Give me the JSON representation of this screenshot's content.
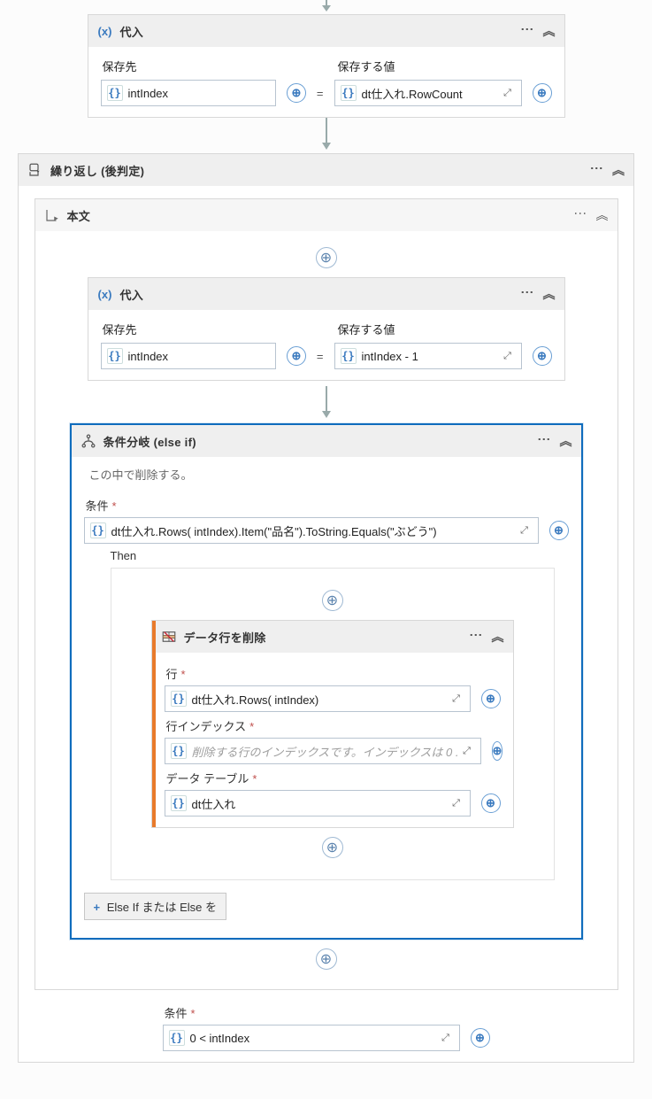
{
  "assign1": {
    "title": "代入",
    "save_to_label": "保存先",
    "save_value_label": "保存する値",
    "save_to": "intIndex",
    "save_value": "dt仕入れ.RowCount"
  },
  "dowhile": {
    "title": "繰り返し (後判定)"
  },
  "body": {
    "title": "本文"
  },
  "assign2": {
    "title": "代入",
    "save_to_label": "保存先",
    "save_value_label": "保存する値",
    "save_to": "intIndex",
    "save_value": "intIndex - 1"
  },
  "elseif": {
    "title": "条件分岐 (else if)",
    "comment": "この中で削除する。",
    "condition_label": "条件",
    "condition": "dt仕入れ.Rows( intIndex).Item(\"品名\").ToString.Equals(\"ぶどう\")",
    "then_label": "Then",
    "addelse_label": "Else If または Else を"
  },
  "removerow": {
    "title": "データ行を削除",
    "row_label": "行",
    "row_value": "dt仕入れ.Rows( intIndex)",
    "rowindex_label": "行インデックス",
    "rowindex_placeholder": "削除する行のインデックスです。インデックスは 0 .",
    "datatable_label": "データ テーブル",
    "datatable_value": "dt仕入れ"
  },
  "dowhile_cond": {
    "label": "条件",
    "value": "0 < intIndex"
  },
  "icons": {
    "var": "（x）",
    "braces": "{ }"
  }
}
